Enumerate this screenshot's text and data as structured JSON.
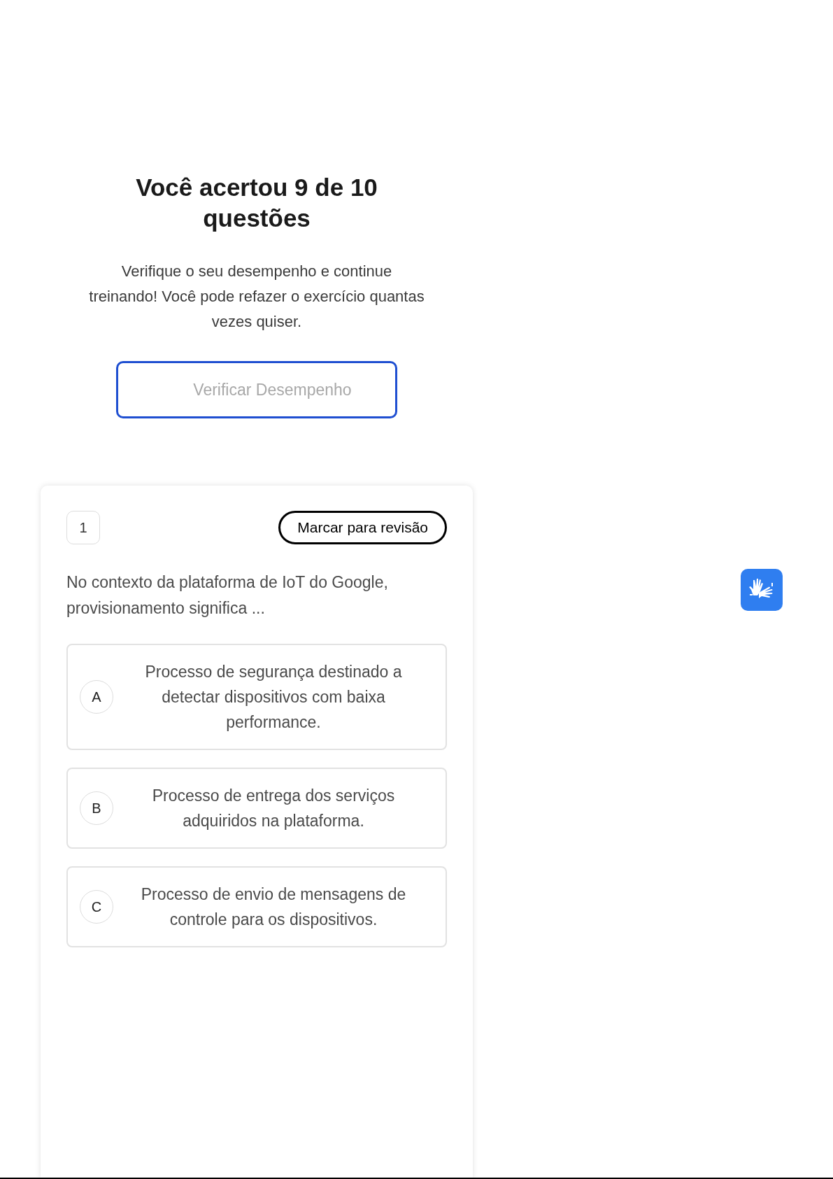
{
  "result": {
    "title": "Você acertou 9 de 10 questões",
    "message": "Verifique o seu desempenho e continue treinando! Você pode refazer o exercício quantas vezes quiser.",
    "button": "Verificar Desempenho"
  },
  "question": {
    "number": "1",
    "review_button": "Marcar para revisão",
    "text": "No contexto da plataforma de IoT do Google, provisionamento significa ...",
    "options": [
      {
        "letter": "A",
        "text": "Processo de segurança destinado a detectar dispositivos com baixa performance.",
        "selected": false
      },
      {
        "letter": "B",
        "text": "Processo de entrega dos serviços adquiridos na plataforma.",
        "selected": false
      },
      {
        "letter": "C",
        "text": "Processo de envio de mensagens de controle para os dispositivos.",
        "selected": false
      }
    ]
  }
}
